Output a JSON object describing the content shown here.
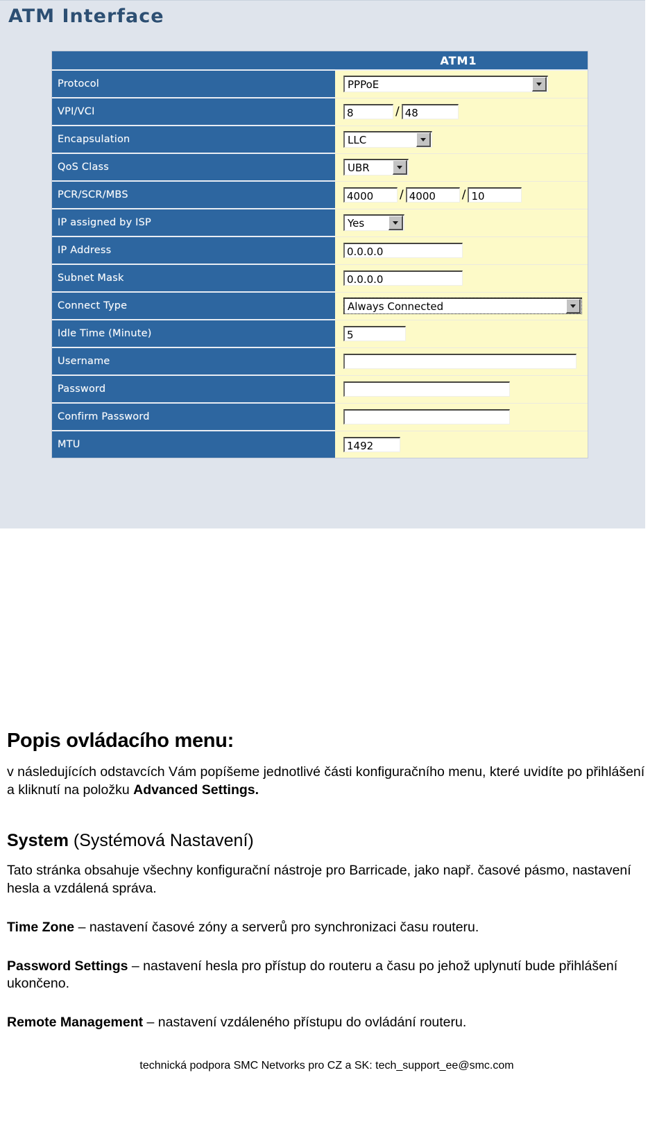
{
  "screenshot": {
    "page_title": "ATM Interface",
    "table": {
      "column_header": "ATM1",
      "rows": [
        {
          "label": "Protocol",
          "control": "select",
          "value": "PPPoE"
        },
        {
          "label": "VPI/VCI",
          "control": "dual",
          "value": "8",
          "value2": "48"
        },
        {
          "label": "Encapsulation",
          "control": "select",
          "value": "LLC"
        },
        {
          "label": "QoS Class",
          "control": "select",
          "value": "UBR"
        },
        {
          "label": "PCR/SCR/MBS",
          "control": "triple",
          "value": "4000",
          "value2": "4000",
          "value3": "10"
        },
        {
          "label": "IP assigned by ISP",
          "control": "select",
          "value": "Yes"
        },
        {
          "label": "IP Address",
          "control": "text",
          "value": "0.0.0.0"
        },
        {
          "label": "Subnet Mask",
          "control": "text",
          "value": "0.0.0.0"
        },
        {
          "label": "Connect Type",
          "control": "select",
          "value": "Always Connected"
        },
        {
          "label": "Idle Time (Minute)",
          "control": "text",
          "value": "5"
        },
        {
          "label": "Username",
          "control": "text",
          "value": ""
        },
        {
          "label": "Password",
          "control": "text",
          "value": ""
        },
        {
          "label": "Confirm Password",
          "control": "text",
          "value": ""
        },
        {
          "label": "MTU",
          "control": "text",
          "value": "1492"
        }
      ]
    },
    "colors": {
      "label_blue": "#2d66a0",
      "field_yellow": "#fdfac8",
      "page_background": "#dfe4ec",
      "title_text": "#2d4f73"
    }
  },
  "document": {
    "heading": "Popis ovládacího menu:",
    "intro_before_bold": "v následujících odstavcích Vám popíšeme jednotlivé části konfiguračního menu, které uvidíte po přihlášení a kliknutí na položku ",
    "intro_bold": "Advanced Settings.",
    "section": {
      "title_bold": "System",
      "title_rest": " (Systémová Nastavení)",
      "paragraph": "Tato stránka obsahuje všechny konfigurační nástroje pro Barricade, jako např. časové pásmo, nastavení hesla a vzdálená správa."
    },
    "items": [
      {
        "term": "Time Zone",
        "desc": " – nastavení časové zóny a serverů pro synchronizaci času routeru."
      },
      {
        "term": "Password Settings",
        "desc": " – nastavení hesla pro přístup do routeru a času po jehož uplynutí bude přihlášení ukončeno."
      },
      {
        "term": "Remote Management",
        "desc": " – nastavení vzdáleného přístupu do ovládání routeru."
      }
    ],
    "footer": "technická podpora SMC Netvorks pro CZ a SK: tech_support_ee@smc.com"
  }
}
